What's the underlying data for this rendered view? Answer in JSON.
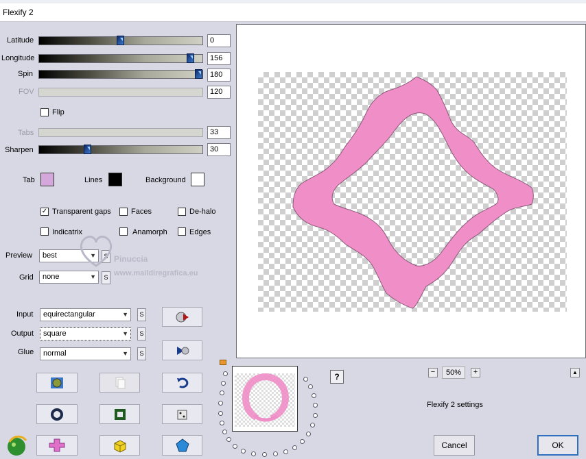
{
  "window": {
    "title": "Flexify 2"
  },
  "sliders": [
    {
      "label": "Latitude",
      "value": "0",
      "level": 0.5,
      "disabled": false
    },
    {
      "label": "Longitude",
      "value": "156",
      "level": 0.93,
      "disabled": false
    },
    {
      "label": "Spin",
      "value": "180",
      "level": 1.0,
      "disabled": false
    },
    {
      "label": "FOV",
      "value": "120",
      "level": null,
      "disabled": true
    },
    {
      "label": "Tabs",
      "value": "33",
      "level": null,
      "disabled": true
    },
    {
      "label": "Sharpen",
      "value": "30",
      "level": 0.3,
      "disabled": false
    }
  ],
  "flip": {
    "label": "Flip",
    "checked": false
  },
  "colors": {
    "tab": {
      "label": "Tab",
      "color": "#d4a8da"
    },
    "lines": {
      "label": "Lines",
      "color": "#000000"
    },
    "background": {
      "label": "Background",
      "color": "#ffffff"
    }
  },
  "options": {
    "transparent_gaps": {
      "label": "Transparent gaps",
      "checked": true
    },
    "faces": {
      "label": "Faces",
      "checked": false
    },
    "de_halo": {
      "label": "De-halo",
      "checked": false
    },
    "indicatrix": {
      "label": "Indicatrix",
      "checked": false
    },
    "anamorph": {
      "label": "Anamorph",
      "checked": false
    },
    "edges": {
      "label": "Edges",
      "checked": false
    }
  },
  "preview": {
    "label": "Preview",
    "value": "best",
    "s_label": "S"
  },
  "grid": {
    "label": "Grid",
    "value": "none",
    "s_label": "S"
  },
  "input": {
    "label": "Input",
    "value": "equirectangular",
    "s_label": "S"
  },
  "output": {
    "label": "Output",
    "value": "square",
    "s_label": "S"
  },
  "glue": {
    "label": "Glue",
    "value": "normal",
    "s_label": "S"
  },
  "watermark": {
    "name": "Pinuccia",
    "site": "www.maildiregrafica.eu"
  },
  "zoom": {
    "minus": "−",
    "value": "50%",
    "plus": "+"
  },
  "scroll_up_label": "▲",
  "help_label": "?",
  "settings_label": "Flexify 2 settings",
  "buttons": {
    "cancel": "Cancel",
    "ok": "OK"
  },
  "shape_color": "#f08ec8",
  "accent_color": "#2f6fbf"
}
